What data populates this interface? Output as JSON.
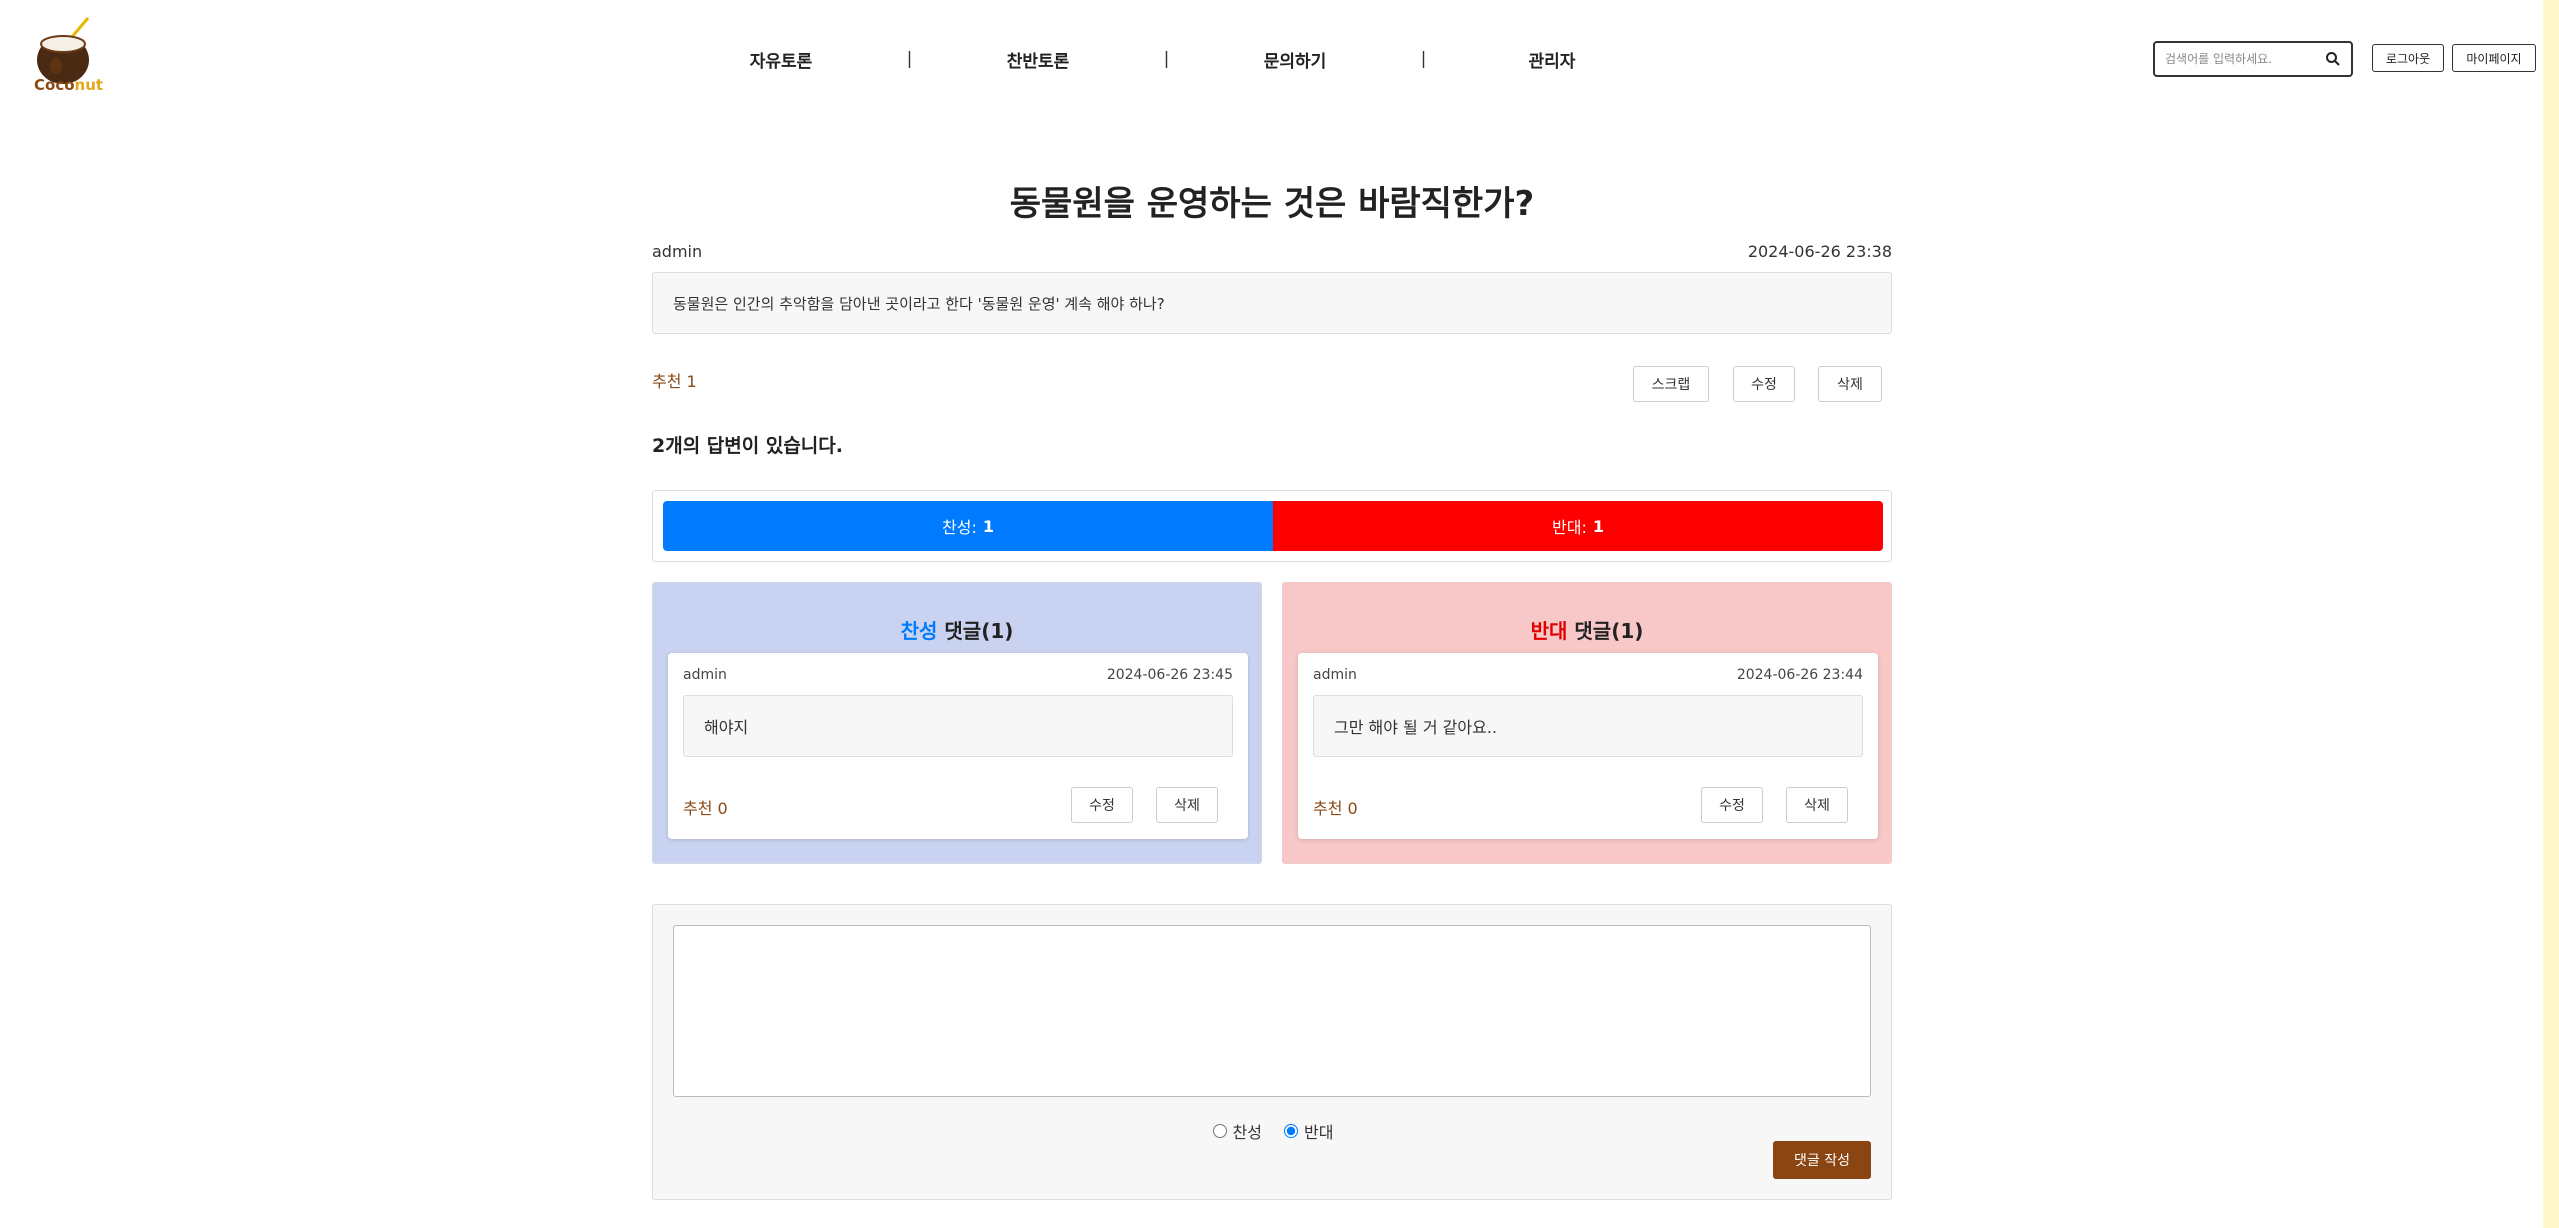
{
  "header": {
    "logo": {
      "part1": "Coco",
      "part2": "nut"
    },
    "nav": [
      {
        "label": "자유토론"
      },
      {
        "label": "찬반토론"
      },
      {
        "label": "문의하기"
      },
      {
        "label": "관리자"
      }
    ],
    "nav_separator": "|",
    "search": {
      "placeholder": "검색어를 입력하세요."
    },
    "logout_label": "로그아웃",
    "mypage_label": "마이페이지"
  },
  "post": {
    "title": "동물원을 운영하는 것은 바람직한가?",
    "author": "admin",
    "date": "2024-06-26 23:38",
    "content": "동물원은 인간의 추악함을 담아낸 곳이라고 한다 '동물원 운영' 계속 해야 하나?",
    "recommend_label": "추천",
    "recommend_count": "1",
    "scrap_label": "스크랩",
    "edit_label": "수정",
    "delete_label": "삭제"
  },
  "answer_count_text": "2개의 답변이 있습니다.",
  "votes": {
    "pro_label": "찬성:",
    "pro_count": "1",
    "con_label": "반대:",
    "con_count": "1",
    "pro_fraction": 0.5
  },
  "pro_panel": {
    "side_word": "찬성",
    "title_suffix": "댓글(1)",
    "comments": [
      {
        "author": "admin",
        "date": "2024-06-26 23:45",
        "content": "해야지",
        "recommend": "추천 0",
        "edit": "수정",
        "delete": "삭제"
      }
    ]
  },
  "con_panel": {
    "side_word": "반대",
    "title_suffix": "댓글(1)",
    "comments": [
      {
        "author": "admin",
        "date": "2024-06-26 23:44",
        "content": "그만 해야 될 거 같아요..",
        "recommend": "추천 0",
        "edit": "수정",
        "delete": "삭제"
      }
    ]
  },
  "comment_form": {
    "textarea_value": "",
    "radio_pro_label": "찬성",
    "radio_con_label": "반대",
    "selected": "반대",
    "submit_label": "댓글 작성"
  },
  "colors": {
    "brand_brown": "#8b4513",
    "pro_blue": "#007bff",
    "con_red": "#ff0000",
    "pro_panel_bg": "#c9d3f1",
    "con_panel_bg": "#f7c8c7"
  }
}
